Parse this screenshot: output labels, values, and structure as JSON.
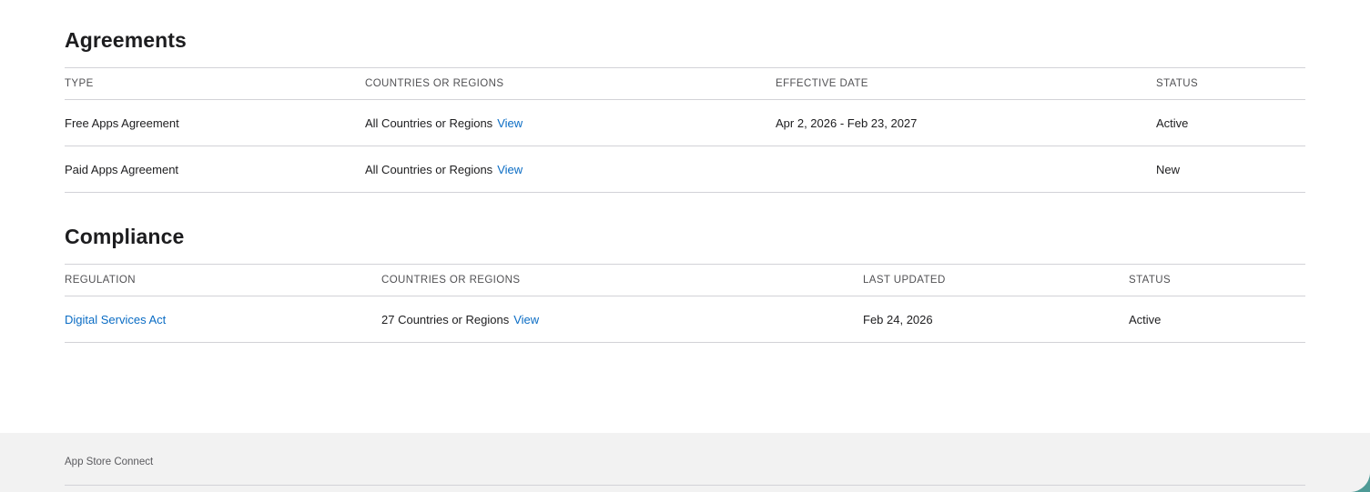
{
  "agreements": {
    "title": "Agreements",
    "columns": [
      "TYPE",
      "COUNTRIES OR REGIONS",
      "EFFECTIVE DATE",
      "STATUS"
    ],
    "rows": [
      {
        "type": "Free Apps Agreement",
        "countries": "All Countries or Regions",
        "view_label": "View",
        "effective_date": "Apr 2, 2026 - Feb 23, 2027",
        "status": "Active"
      },
      {
        "type": "Paid Apps Agreement",
        "countries": "All Countries or Regions",
        "view_label": "View",
        "effective_date": "",
        "status": "New"
      }
    ]
  },
  "compliance": {
    "title": "Compliance",
    "columns": [
      "REGULATION",
      "COUNTRIES OR REGIONS",
      "LAST UPDATED",
      "STATUS"
    ],
    "rows": [
      {
        "regulation": "Digital Services Act",
        "countries": "27 Countries or Regions",
        "view_label": "View",
        "last_updated": "Feb 24, 2026",
        "status": "Active"
      }
    ]
  },
  "footer": {
    "text": "App Store Connect"
  },
  "colors": {
    "link": "#0a6cc4",
    "divider": "#d2d2d7",
    "footer_bg": "#f2f2f2",
    "desktop_bg": "#4e9a96"
  }
}
